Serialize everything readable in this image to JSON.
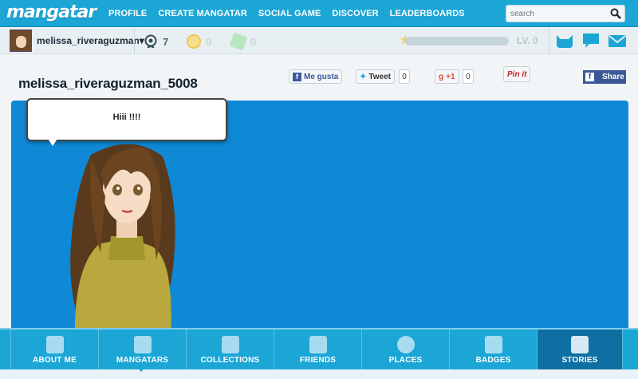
{
  "app": {
    "logo": "mangatar"
  },
  "nav": {
    "links": [
      "PROFILE",
      "CREATE MANGATAR",
      "SOCIAL GAME",
      "DISCOVER",
      "LEADERBOARDS"
    ]
  },
  "search": {
    "placeholder": "search"
  },
  "userbar": {
    "username": "melissa_riveraguzman",
    "dropdown_glyph": "▾",
    "stats": [
      {
        "icon": "badge-icon",
        "value": "7",
        "color": "#2f4a5a"
      },
      {
        "icon": "coin-icon",
        "value": "0",
        "color": "#f0c84c"
      },
      {
        "icon": "gem-icon",
        "value": "0",
        "color": "#9ed9a6"
      }
    ],
    "level": "LV. 0",
    "xp_progress": 0.0
  },
  "page": {
    "title": "melissa_riveraguzman_5008"
  },
  "social": {
    "like_label": "Me gusta",
    "tweet_label": "Tweet",
    "tweet_count": "0",
    "gplus_label": "+1",
    "gplus_count": "0",
    "pin_label": "Pin it",
    "share_label": "Share"
  },
  "stage": {
    "speech": "Hiii !!!!",
    "background": "#0f88d5"
  },
  "tabs": [
    {
      "label": "ABOUT ME",
      "icon": "about-icon"
    },
    {
      "label": "MANGATARS",
      "icon": "mangatars-icon"
    },
    {
      "label": "COLLECTIONS",
      "icon": "collections-icon"
    },
    {
      "label": "FRIENDS",
      "icon": "friends-icon"
    },
    {
      "label": "PLACES",
      "icon": "places-icon"
    },
    {
      "label": "BADGES",
      "icon": "badges-icon"
    },
    {
      "label": "STORIES",
      "icon": "stories-icon"
    }
  ],
  "colors": {
    "brand": "#1ba6d6",
    "active_tab": "#0e6fa3"
  }
}
